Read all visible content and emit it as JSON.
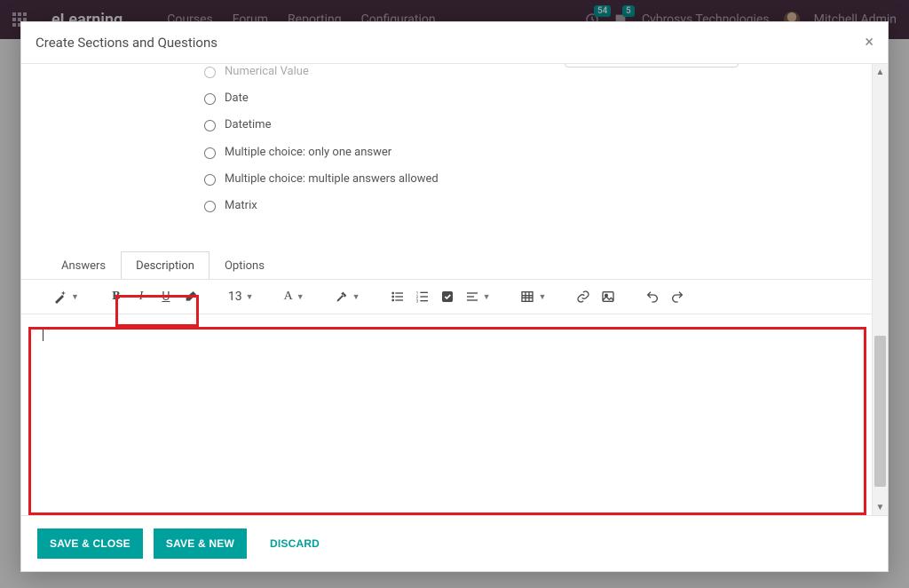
{
  "navbar": {
    "brand": "eLearning",
    "menu": [
      "Courses",
      "Forum",
      "Reporting",
      "Configuration"
    ],
    "badge_clock": "54",
    "badge_chat": "5",
    "company": "Cybrosys Technologies",
    "user": "Mitchell Admin"
  },
  "modal": {
    "title": "Create Sections and Questions",
    "close_glyph": "×"
  },
  "question_types": [
    {
      "key": "numerical",
      "label": "Numerical Value"
    },
    {
      "key": "date",
      "label": "Date"
    },
    {
      "key": "datetime",
      "label": "Datetime"
    },
    {
      "key": "mc_one",
      "label": "Multiple choice: only one answer"
    },
    {
      "key": "mc_many",
      "label": "Multiple choice: multiple answers allowed"
    },
    {
      "key": "matrix",
      "label": "Matrix"
    }
  ],
  "tabs": {
    "answers": "Answers",
    "description": "Description",
    "options": "Options",
    "active": "description"
  },
  "toolbar": {
    "font_size": "13"
  },
  "footer": {
    "save_close": "SAVE & CLOSE",
    "save_new": "SAVE & NEW",
    "discard": "DISCARD"
  }
}
